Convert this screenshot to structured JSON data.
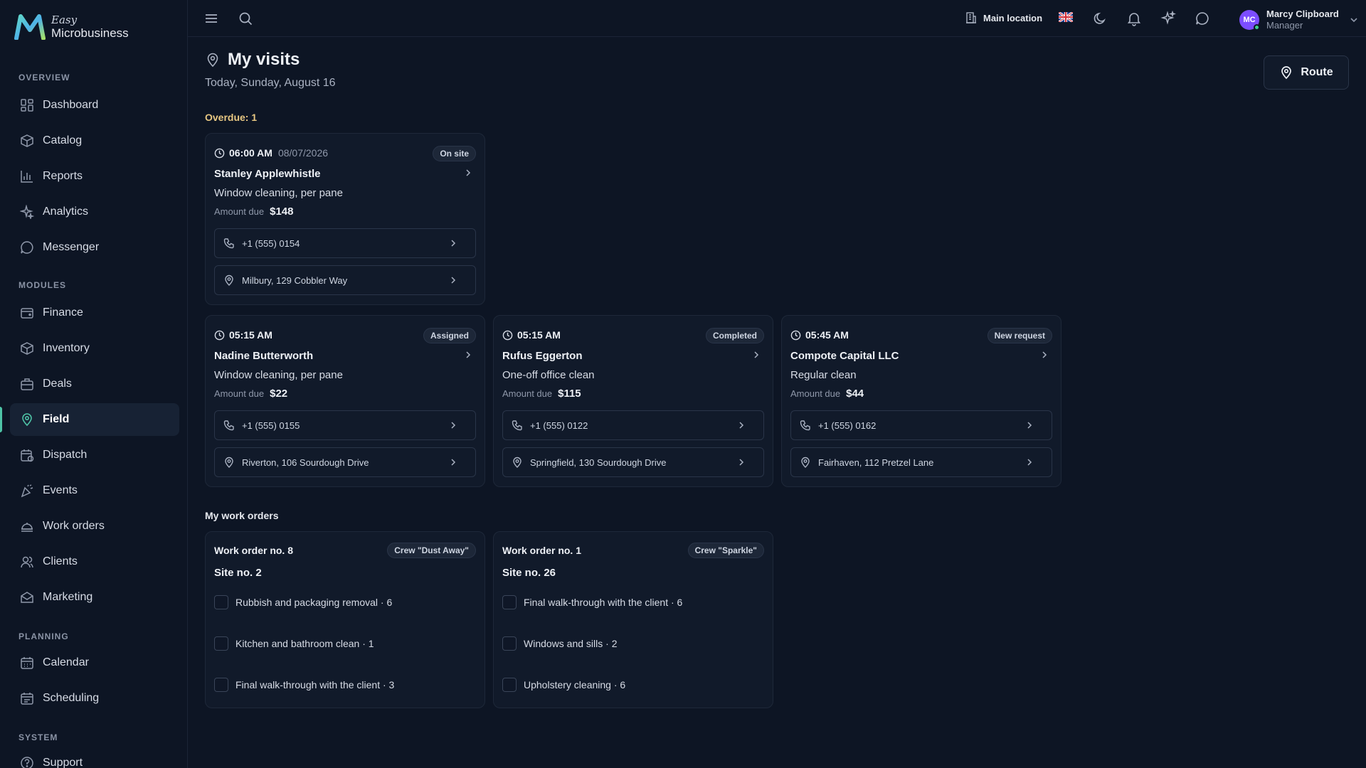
{
  "app": {
    "logo_easy": "Easy",
    "logo_name": "Microbusiness"
  },
  "sidebar": {
    "sections": [
      {
        "label": "OVERVIEW"
      },
      {
        "label": "MODULES"
      },
      {
        "label": "PLANNING"
      },
      {
        "label": "SYSTEM"
      }
    ],
    "items": [
      {
        "label": "Dashboard",
        "icon": "dashboard-icon"
      },
      {
        "label": "Catalog",
        "icon": "catalog-icon"
      },
      {
        "label": "Reports",
        "icon": "reports-icon"
      },
      {
        "label": "Analytics",
        "icon": "analytics-icon"
      },
      {
        "label": "Messenger",
        "icon": "messenger-icon"
      },
      {
        "label": "Finance",
        "icon": "finance-icon"
      },
      {
        "label": "Inventory",
        "icon": "inventory-icon"
      },
      {
        "label": "Deals",
        "icon": "deals-icon"
      },
      {
        "label": "Field",
        "icon": "map-pin-icon",
        "active": true
      },
      {
        "label": "Dispatch",
        "icon": "dispatch-icon"
      },
      {
        "label": "Events",
        "icon": "events-icon"
      },
      {
        "label": "Work orders",
        "icon": "work-orders-icon"
      },
      {
        "label": "Clients",
        "icon": "clients-icon"
      },
      {
        "label": "Marketing",
        "icon": "marketing-icon"
      },
      {
        "label": "Calendar",
        "icon": "calendar-icon"
      },
      {
        "label": "Scheduling",
        "icon": "scheduling-icon"
      },
      {
        "label": "Support",
        "icon": "support-icon"
      }
    ]
  },
  "topbar": {
    "location": "Main location",
    "user_initials": "MC",
    "user_name": "Marcy Clipboard",
    "user_role": "Manager"
  },
  "page": {
    "title": "My visits",
    "date": "Today, Sunday, August 16",
    "route_label": "Route",
    "overdue_label": "Overdue: 1",
    "orders_label": "My work orders"
  },
  "visits": [
    {
      "time": "06:00 AM",
      "date": "08/07/2026",
      "status": "On site",
      "client": "Stanley Applewhistle",
      "service": "Window cleaning, per pane",
      "amount_label": "Amount due",
      "amount": "$148",
      "phone": "+1 (555) 0154",
      "address": "Milbury, 129 Cobbler Way"
    },
    {
      "time": "05:15 AM",
      "date": "",
      "status": "Assigned",
      "client": "Nadine Butterworth",
      "service": "Window cleaning, per pane",
      "amount_label": "Amount due",
      "amount": "$22",
      "phone": "+1 (555) 0155",
      "address": "Riverton, 106 Sourdough Drive"
    },
    {
      "time": "05:15 AM",
      "date": "",
      "status": "Completed",
      "client": "Rufus Eggerton",
      "service": "One-off office clean",
      "amount_label": "Amount due",
      "amount": "$115",
      "phone": "+1 (555) 0122",
      "address": "Springfield, 130 Sourdough Drive"
    },
    {
      "time": "05:45 AM",
      "date": "",
      "status": "New request",
      "client": "Compote Capital LLC",
      "service": "Regular clean",
      "amount_label": "Amount due",
      "amount": "$44",
      "phone": "+1 (555) 0162",
      "address": "Fairhaven, 112 Pretzel Lane"
    }
  ],
  "work_orders": [
    {
      "title": "Work order no. 8",
      "crew": "Crew \"Dust Away\"",
      "site": "Site no. 2",
      "tasks": [
        {
          "label": "Rubbish and packaging removal · 6"
        },
        {
          "label": "Kitchen and bathroom clean · 1"
        },
        {
          "label": "Final walk-through with the client · 3"
        }
      ]
    },
    {
      "title": "Work order no. 1",
      "crew": "Crew \"Sparkle\"",
      "site": "Site no. 26",
      "tasks": [
        {
          "label": "Final walk-through with the client · 6"
        },
        {
          "label": "Windows and sills · 2"
        },
        {
          "label": "Upholstery cleaning · 6"
        }
      ]
    }
  ],
  "colors": {
    "background": "#0d1524",
    "card": "#111a2a",
    "accent": "#4ec3a6",
    "overdue": "#e8c883",
    "avatar": "#7c4dff"
  }
}
